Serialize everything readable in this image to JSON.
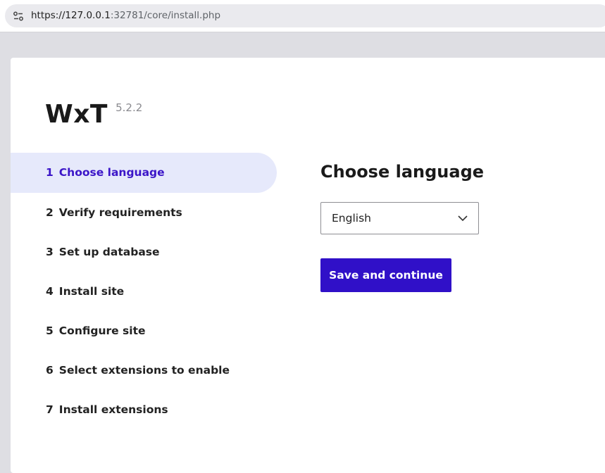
{
  "browser": {
    "url_host": "https://127.0.0.1",
    "url_rest": ":32781/core/install.php",
    "site_icon": "site-settings-icon"
  },
  "brand": {
    "name": "WxT",
    "version": "5.2.2"
  },
  "steps": [
    {
      "num": "1",
      "label": "Choose language",
      "active": true
    },
    {
      "num": "2",
      "label": "Verify requirements",
      "active": false
    },
    {
      "num": "3",
      "label": "Set up database",
      "active": false
    },
    {
      "num": "4",
      "label": "Install site",
      "active": false
    },
    {
      "num": "5",
      "label": "Configure site",
      "active": false
    },
    {
      "num": "6",
      "label": "Select extensions to enable",
      "active": false
    },
    {
      "num": "7",
      "label": "Install extensions",
      "active": false
    }
  ],
  "main": {
    "title": "Choose language",
    "language_select": {
      "value": "English",
      "icon": "chevron-down-icon"
    },
    "submit_label": "Save and continue"
  },
  "colors": {
    "accent": "#3010c8",
    "active_step_bg": "#e6e9fb",
    "active_step_text": "#3b15c8",
    "page_bg": "#dedee3"
  }
}
